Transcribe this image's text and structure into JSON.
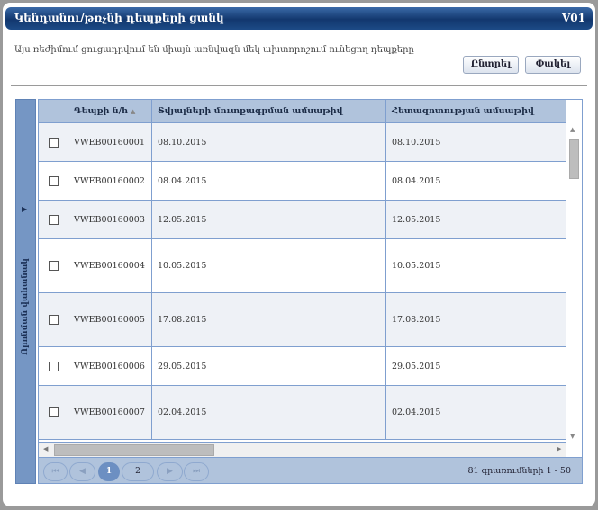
{
  "window": {
    "title": "Կենդանու/թռչնի դեպքերի ցանկ",
    "version": "V01"
  },
  "description": "Այս ռեժիմում ցուցադրվում են միայն առնվազն մեկ ախտորոշում ունեցող դեպքերը",
  "buttons": {
    "select": "Ընտրել",
    "close": "Փակել"
  },
  "side_panel": {
    "label": "Որոնման վահանակ",
    "icon": "triangle-right-icon"
  },
  "table": {
    "columns": [
      "Դեպքի ն/h",
      "Տվյալների մուտքագրման ամսաթիվ",
      "Հետազոտության ամսաթիվ"
    ],
    "sort": {
      "column": 0,
      "direction": "ascending"
    },
    "rows": [
      {
        "id": "VWEB00160001",
        "entry_date": "08.10.2015",
        "study_date": "08.10.2015",
        "checked": false
      },
      {
        "id": "VWEB00160002",
        "entry_date": "08.04.2015",
        "study_date": "08.04.2015",
        "checked": false
      },
      {
        "id": "VWEB00160003",
        "entry_date": "12.05.2015",
        "study_date": "12.05.2015",
        "checked": false
      },
      {
        "id": "VWEB00160004",
        "entry_date": "10.05.2015",
        "study_date": "10.05.2015",
        "checked": false
      },
      {
        "id": "VWEB00160005",
        "entry_date": "17.08.2015",
        "study_date": "17.08.2015",
        "checked": false
      },
      {
        "id": "VWEB00160006",
        "entry_date": "29.05.2015",
        "study_date": "29.05.2015",
        "checked": false
      },
      {
        "id": "VWEB00160007",
        "entry_date": "02.04.2015",
        "study_date": "02.04.2015",
        "checked": false
      }
    ]
  },
  "pager": {
    "pages": [
      "1",
      "2"
    ],
    "current": "1",
    "info": "81 գրառումների 1 - 50"
  },
  "colors": {
    "header": "#12376e",
    "grid_header": "#b0c3dc",
    "side_panel": "#7596c4",
    "active_page": "#6c8fc2"
  }
}
